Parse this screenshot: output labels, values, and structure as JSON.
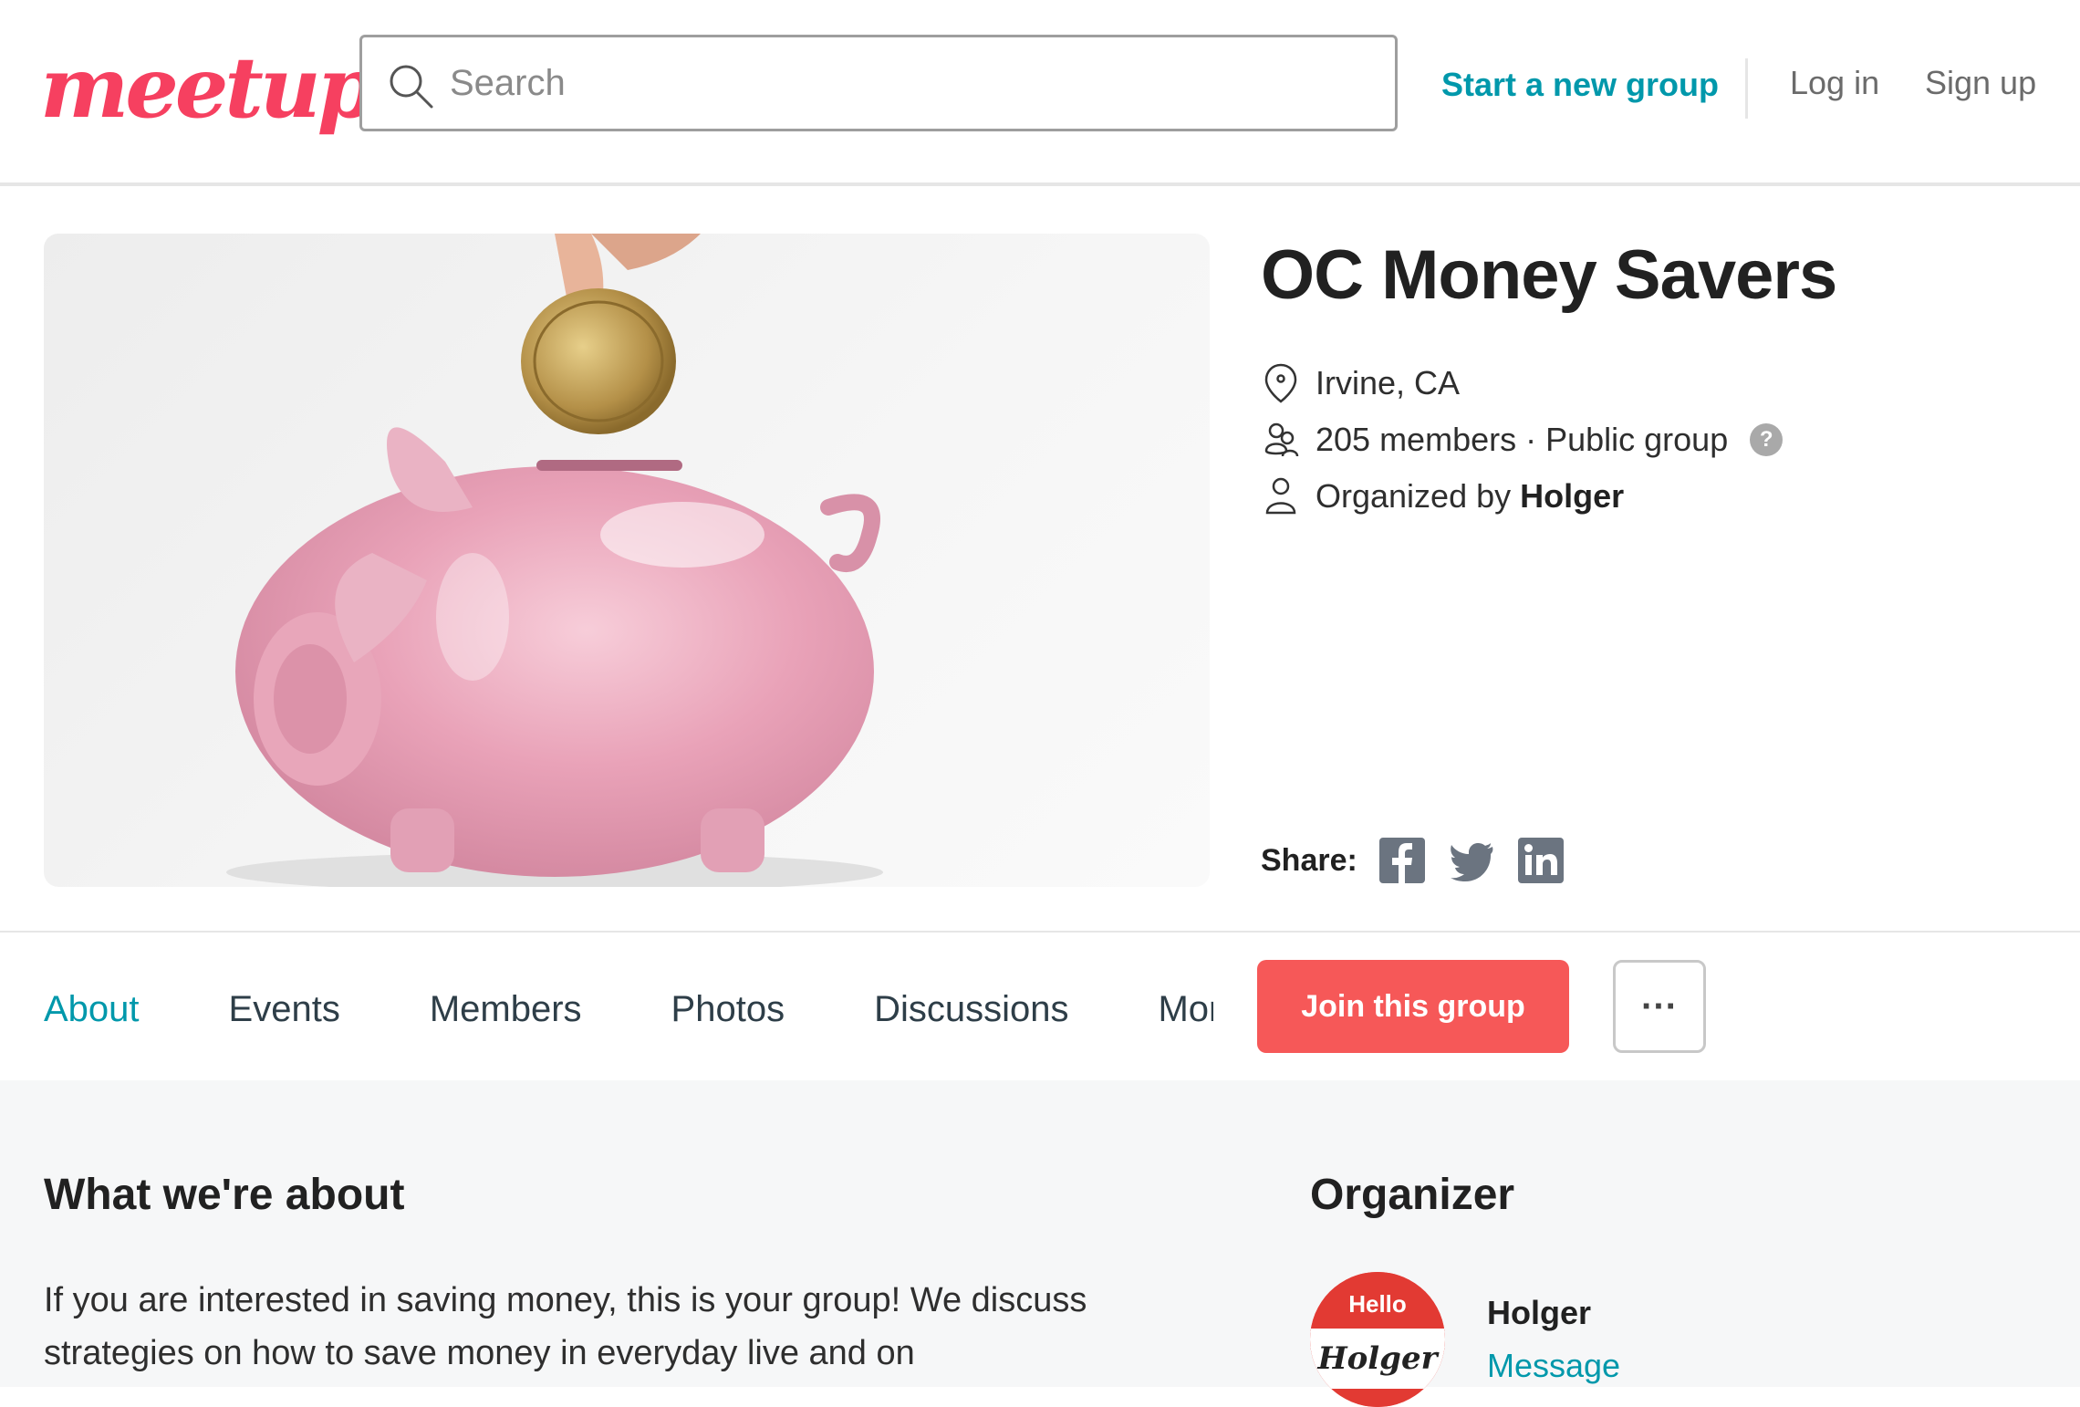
{
  "header": {
    "logo_text": "meetup",
    "search_placeholder": "Search",
    "start_group": "Start a new group",
    "login": "Log in",
    "signup": "Sign up",
    "brand_color": "#f64060",
    "link_color": "#0098ab"
  },
  "group": {
    "title": "OC Money Savers",
    "location": "Irvine, CA",
    "members": "205 members · Public group",
    "organized_prefix": "Organized by ",
    "organizer": "Holger",
    "share_label": "Share:",
    "share_icons": [
      "facebook-icon",
      "twitter-icon",
      "linkedin-icon"
    ],
    "hero_image": "piggy bank with coin"
  },
  "tabs": [
    {
      "label": "About",
      "active": true
    },
    {
      "label": "Events"
    },
    {
      "label": "Members"
    },
    {
      "label": "Photos"
    },
    {
      "label": "Discussions"
    },
    {
      "label": "More"
    }
  ],
  "actions": {
    "join": "Join this group",
    "more": "···",
    "join_color": "#f65858"
  },
  "about": {
    "heading": "What we're about",
    "text": "If you are interested in saving money, this is your group! We discuss strategies on how to save money in everyday live and on"
  },
  "organizer_box": {
    "heading": "Organizer",
    "name": "Holger",
    "message": "Message",
    "badge_hello": "Hello",
    "badge_name": "Holger"
  }
}
